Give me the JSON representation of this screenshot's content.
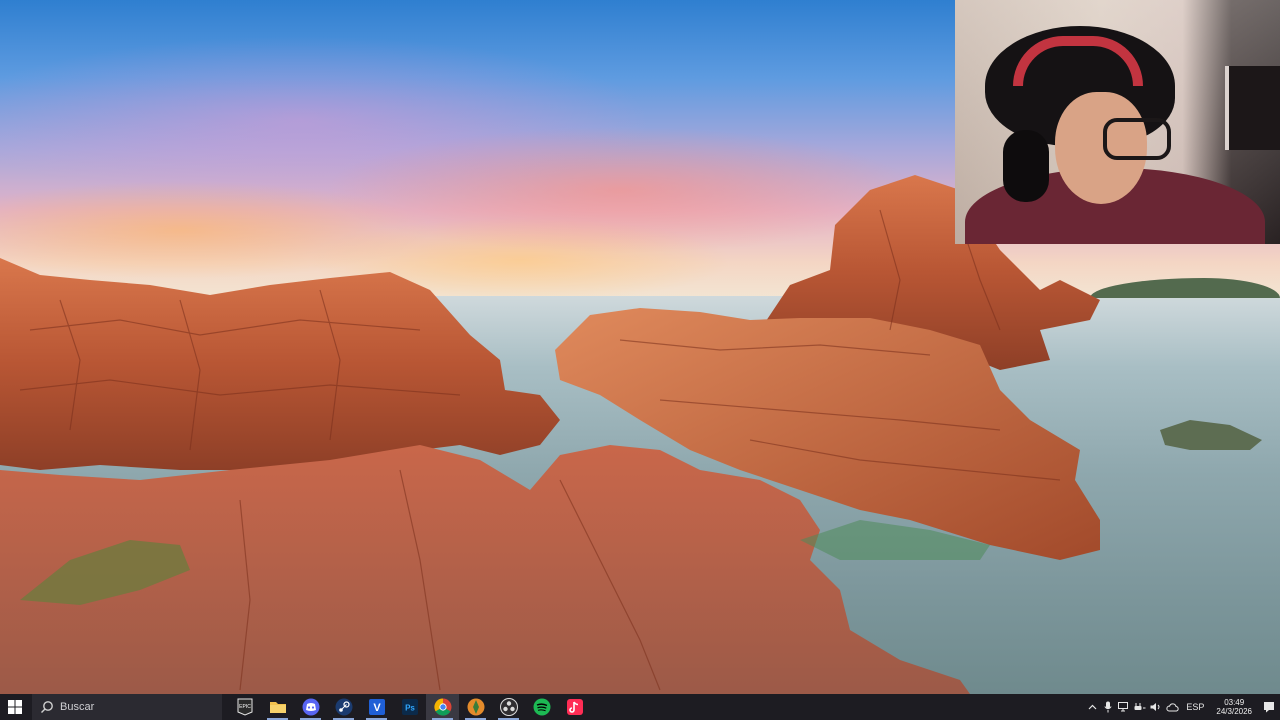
{
  "wallpaper": {
    "subject": "red-rock-coast-sunset"
  },
  "webcam_overlay": {
    "subject": "streamer-with-headphones"
  },
  "taskbar": {
    "start_icon": "windows-logo-icon",
    "search": {
      "placeholder": "Buscar",
      "icon": "search-icon"
    },
    "apps": [
      {
        "name": "epic-games",
        "icon_text": "EPIC",
        "color": "#2b2b2b"
      },
      {
        "name": "file-explorer",
        "icon_text": "",
        "color": "#f2c14e"
      },
      {
        "name": "discord",
        "icon_text": "",
        "color": "#5865f2"
      },
      {
        "name": "steam",
        "icon_text": "",
        "color": "#1b3b6f"
      },
      {
        "name": "vegas",
        "icon_text": "V",
        "color": "#1f5fd6"
      },
      {
        "name": "photoshop",
        "icon_text": "Ps",
        "color": "#0b2a4a"
      },
      {
        "name": "chrome",
        "icon_text": "",
        "color": "#34a853"
      },
      {
        "name": "app-orange",
        "icon_text": "",
        "color": "#e48b2b"
      },
      {
        "name": "obs",
        "icon_text": "",
        "color": "#302e31"
      },
      {
        "name": "spotify",
        "icon_text": "",
        "color": "#1db954"
      },
      {
        "name": "tiktok",
        "icon_text": "",
        "color": "#ff2d55"
      }
    ],
    "tray": {
      "language": "ESP",
      "time": "03:49",
      "date": "24/3/2026"
    }
  }
}
